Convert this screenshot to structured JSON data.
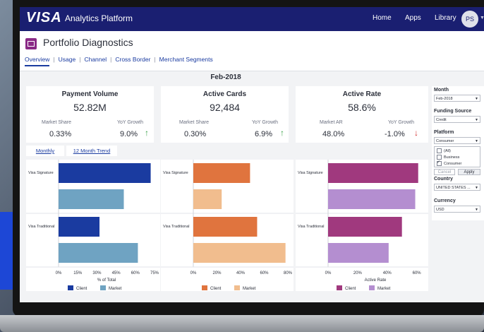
{
  "header": {
    "brand": "VISA",
    "app_title": "Analytics Platform",
    "nav": [
      "Home",
      "Apps",
      "Library"
    ],
    "avatar": "PS"
  },
  "page": {
    "title": "Portfolio Diagnostics",
    "tabs": [
      "Overview",
      "Usage",
      "Channel",
      "Cross Border",
      "Merchant Segments"
    ],
    "period": "Feb-2018"
  },
  "kpis": [
    {
      "title": "Payment Volume",
      "value": "52.82M",
      "left_label": "Market Share",
      "left_value": "0.33%",
      "right_label": "YoY Growth",
      "right_value": "9.0%",
      "trend": "up"
    },
    {
      "title": "Active Cards",
      "value": "92,484",
      "left_label": "Market Share",
      "left_value": "0.30%",
      "right_label": "YoY Growth",
      "right_value": "6.9%",
      "trend": "up"
    },
    {
      "title": "Active Rate",
      "value": "58.6%",
      "left_label": "Market AR",
      "left_value": "48.0%",
      "right_label": "YoY Growth",
      "right_value": "-1.0%",
      "trend": "down"
    }
  ],
  "toggles": {
    "monthly": "Monthly",
    "trend": "12 Month Trend"
  },
  "filters": {
    "month_label": "Month",
    "month_value": "Feb-2018",
    "funding_label": "Funding Source",
    "funding_value": "Credit",
    "platform_label": "Platform",
    "platform_value": "Consumer",
    "platform_options": [
      "(All)",
      "Business",
      "Consumer"
    ],
    "cancel": "Cancel",
    "apply": "Apply",
    "country_label": "Country",
    "country_value": "UNITED STATES ...",
    "currency_label": "Currency",
    "currency_value": "USD"
  },
  "colors": {
    "navy": "#1a1f71",
    "up": "#3aa348",
    "down": "#d42d2d"
  },
  "chart_data": [
    {
      "type": "bar",
      "categories": [
        "Visa Signature",
        "Visa Traditional"
      ],
      "series": [
        {
          "name": "Client",
          "values": [
            72,
            32
          ],
          "color": "#1a3ba0"
        },
        {
          "name": "Market",
          "values": [
            51,
            62
          ],
          "color": "#6fa3c2"
        }
      ],
      "xlabel": "% of Total",
      "ticks": [
        "0%",
        "15%",
        "30%",
        "45%",
        "60%",
        "75%"
      ],
      "xlim": [
        0,
        75
      ]
    },
    {
      "type": "bar",
      "categories": [
        "Visa Signature",
        "Visa Traditional"
      ],
      "series": [
        {
          "name": "Client",
          "values": [
            48,
            54
          ],
          "color": "#e0743e"
        },
        {
          "name": "Market",
          "values": [
            24,
            78
          ],
          "color": "#f1bd8e"
        }
      ],
      "xlabel": "",
      "ticks": [
        "0%",
        "20%",
        "40%",
        "60%",
        "80%"
      ],
      "xlim": [
        0,
        80
      ]
    },
    {
      "type": "bar",
      "categories": [
        "Visa Signature",
        "Visa Traditional"
      ],
      "series": [
        {
          "name": "Client",
          "values": [
            61,
            50
          ],
          "color": "#a0397e"
        },
        {
          "name": "Market",
          "values": [
            59,
            41
          ],
          "color": "#b48ed0"
        }
      ],
      "xlabel": "Active Rate",
      "ticks": [
        "0%",
        "20%",
        "40%",
        "60%"
      ],
      "xlim": [
        0,
        64
      ]
    }
  ]
}
